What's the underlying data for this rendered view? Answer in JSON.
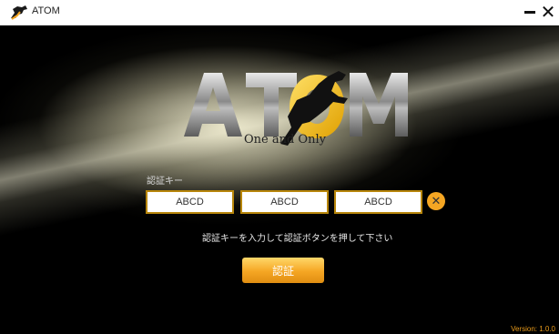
{
  "window": {
    "title": "ATOM",
    "minimize_icon": "minimize-icon",
    "close_icon": "close-icon"
  },
  "logo": {
    "text": "ATOM",
    "slogan": "One and Only"
  },
  "form": {
    "label": "認証キー",
    "inputs": [
      "ABCD",
      "ABCD",
      "ABCD"
    ],
    "clear_symbol": "✕",
    "instruction": "認証キーを入力して認証ボタンを押して下さい",
    "submit_label": "認証"
  },
  "footer": {
    "version": "Version: 1.0.0"
  },
  "colors": {
    "accent": "#f5a623",
    "input_border": "#b8860b",
    "version_text": "#e89a1a"
  }
}
